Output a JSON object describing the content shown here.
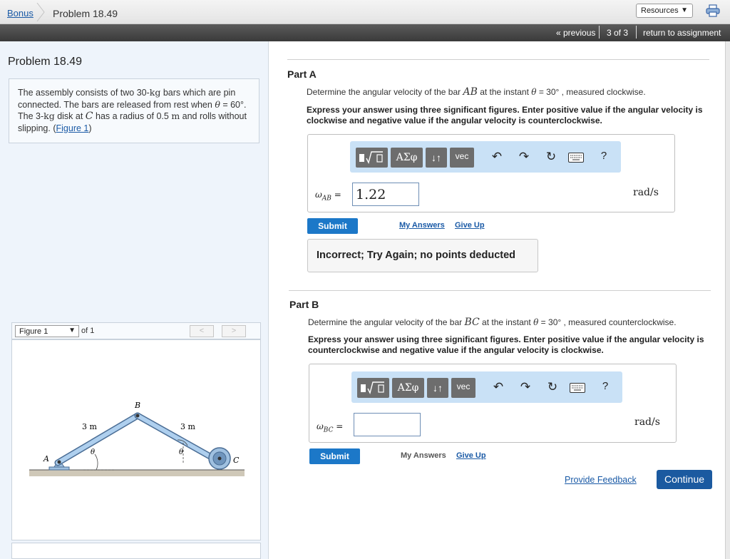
{
  "breadcrumb": {
    "bonus": "Bonus",
    "problem": "Problem 18.49"
  },
  "resources": {
    "label": "Resources",
    "caret": "▼"
  },
  "nav": {
    "previous": "« previous",
    "pager": "3 of 3",
    "return": "return to assignment"
  },
  "left": {
    "title": "Problem 18.49",
    "statement": {
      "s1": "The assembly consists of two 30-",
      "kg1": "kg",
      "s2": " bars which are pin connected. The bars are released from rest when ",
      "theta1": "θ",
      "s3": " = 60°. The 3-",
      "kg2": "kg",
      "s4": " disk at ",
      "c": "C",
      "s5": " has a radius of 0.5 ",
      "m": "m",
      "s6": " and rolls without slipping. (",
      "figlink": "Figure 1",
      "s7": ")"
    },
    "figure": {
      "select": "Figure 1",
      "caret": "▼",
      "of": "of 1",
      "prev": "<",
      "next": ">",
      "labels": {
        "a": "A",
        "b": "B",
        "c": "C",
        "len_left": "3 m",
        "len_right": "3 m",
        "theta_left": "θ",
        "theta_right": "θ"
      }
    }
  },
  "partA": {
    "title": "Part A",
    "q1": "Determine the angular velocity of the bar ",
    "bar": "AB",
    "q2": " at the instant ",
    "theta": "θ",
    "q3": " = 30° , measured clockwise.",
    "instructions": "Express your answer using three significant figures. Enter positive value if the angular velocity is clockwise and negative value if the angular velocity is counterclockwise.",
    "var_main": "ω",
    "var_sub": "AB",
    "eq": " =",
    "value": "1.22",
    "unit": "rad/s",
    "submit": "Submit",
    "my_answers": "My Answers",
    "give_up": "Give Up",
    "feedback": "Incorrect; Try Again; no points deducted"
  },
  "partB": {
    "title": "Part B",
    "q1": "Determine the angular velocity of the bar ",
    "bar": "BC",
    "q2": " at the instant ",
    "theta": "θ",
    "q3": " = 30° , measured counterclockwise.",
    "instructions": "Express your answer using three significant figures. Enter positive value if the angular velocity is counterclockwise and negative value if the angular velocity is clockwise.",
    "var_main": "ω",
    "var_sub": "BC",
    "eq": " =",
    "value": "",
    "unit": "rad/s",
    "submit": "Submit",
    "my_answers": "My Answers",
    "give_up": "Give Up"
  },
  "toolbar": {
    "greek": "ΑΣφ",
    "arrows": "↓↑",
    "vec": "vec",
    "help": "?"
  },
  "footer": {
    "provide_feedback": "Provide Feedback",
    "continue": "Continue"
  }
}
